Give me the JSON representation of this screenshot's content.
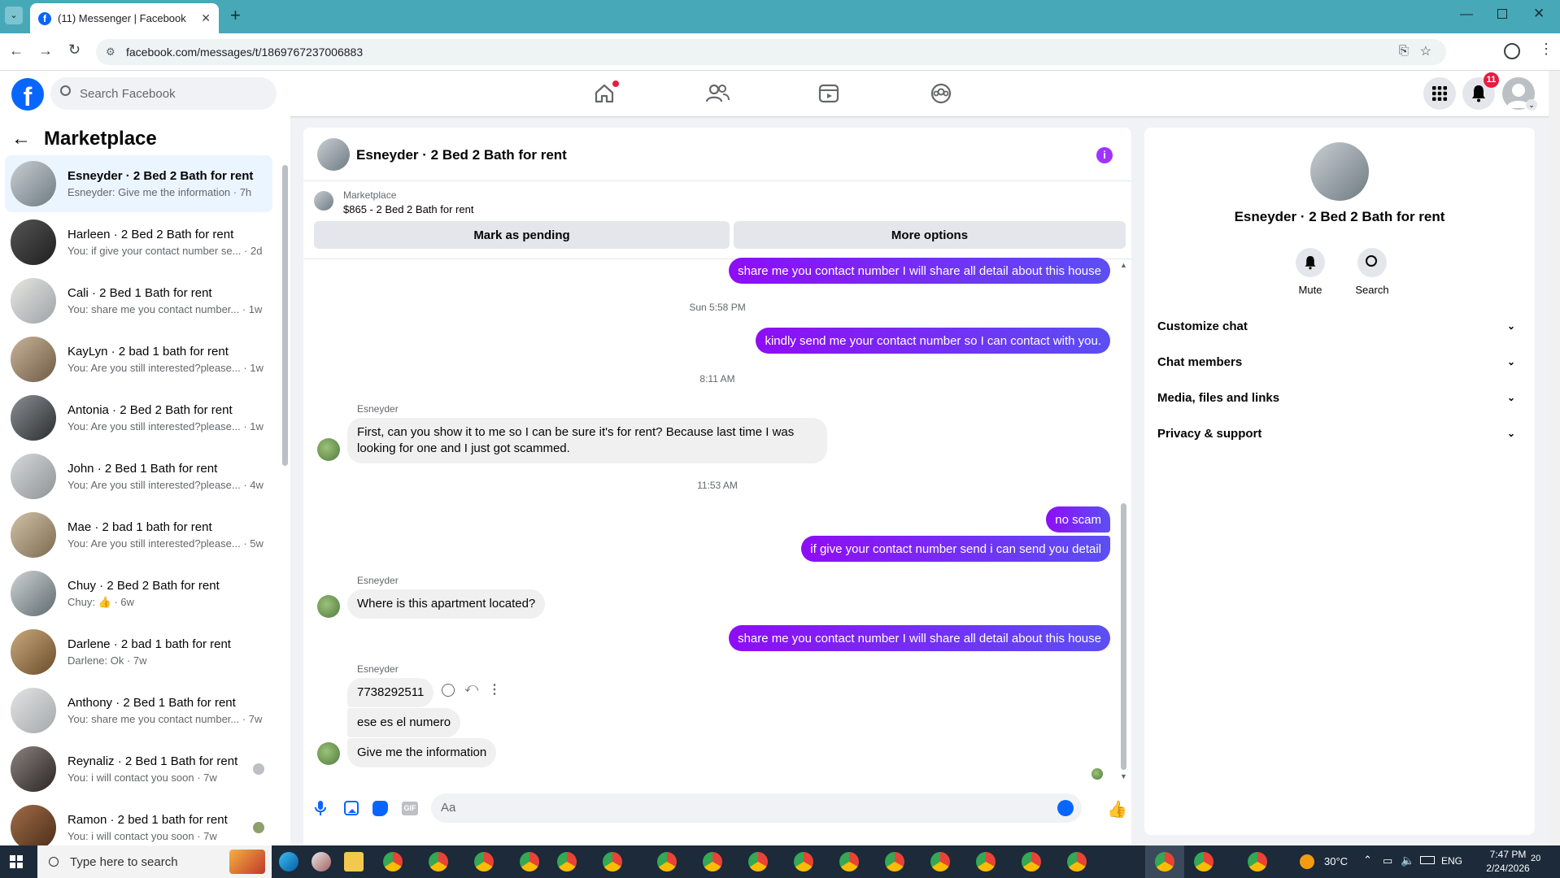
{
  "browser": {
    "tab_title": "(11) Messenger | Facebook",
    "url": "facebook.com/messages/t/1869767237006883"
  },
  "fbnav": {
    "search_placeholder": "Search Facebook",
    "notif_count": "11"
  },
  "left": {
    "title": "Marketplace",
    "conversations": [
      {
        "title": "Esneyder · 2 Bed 2 Bath for rent",
        "preview": "Esneyder: Give me the information · 7h"
      },
      {
        "title": "Harleen · 2 Bed 2 Bath for rent",
        "preview": "You: if give your contact number se... · 2d"
      },
      {
        "title": "Cali · 2 Bed 1 Bath for rent",
        "preview": "You: share me you contact number... · 1w"
      },
      {
        "title": "KayLyn · 2 bad 1 bath for rent",
        "preview": "You: Are you still interested?please... · 1w"
      },
      {
        "title": "Antonia · 2 Bed 2 Bath for rent",
        "preview": "You: Are you still interested?please... · 1w"
      },
      {
        "title": "John · 2 Bed 1 Bath for rent",
        "preview": "You: Are you still interested?please... · 4w"
      },
      {
        "title": "Mae · 2 bad 1 bath for rent",
        "preview": "You: Are you still interested?please... · 5w"
      },
      {
        "title": "Chuy · 2 Bed 2 Bath for rent",
        "preview": "Chuy: 👍 · 6w"
      },
      {
        "title": "Darlene · 2 bad 1 bath for rent",
        "preview": "Darlene: Ok · 7w"
      },
      {
        "title": "Anthony · 2 Bed 1 Bath for rent",
        "preview": "You: share me you contact number... · 7w"
      },
      {
        "title": "Reynaliz · 2 Bed 1 Bath for rent",
        "preview": "You: i will contact you soon · 7w"
      },
      {
        "title": "Ramon · 2 bed 1 bath for rent",
        "preview": "You: i will contact you soon · 7w"
      }
    ]
  },
  "chat": {
    "header_title": "Esneyder · 2 Bed 2 Bath for rent",
    "listing_source": "Marketplace",
    "listing_title": "$865 - 2 Bed 2 Bath for rent",
    "mark_pending_label": "Mark as pending",
    "more_options_label": "More options",
    "messages": {
      "m1": "share me you contact number I will share all detail about this house",
      "ts1": "Sun 5:58 PM",
      "m2": "kindly send me your contact number so I can contact with you.",
      "ts2": "8:11 AM",
      "sender": "Esneyder",
      "m3": "First, can you show it to me so I can be sure it's for rent? Because last time I was looking for one and I just got scammed.",
      "ts3": "11:53 AM",
      "m4": "no scam",
      "m5": "if give your contact number send i can send you detail",
      "m6": "Where is this apartment located?",
      "m7": "share me you contact number I will share all detail about this house",
      "m8": "7738292511",
      "m9": "ese es el numero",
      "m10": "Give me the information"
    },
    "composer_placeholder": "Aa"
  },
  "right": {
    "title": "Esneyder · 2 Bed 2 Bath for rent",
    "mute_label": "Mute",
    "search_label": "Search",
    "sections": [
      "Customize chat",
      "Chat members",
      "Media, files and links",
      "Privacy & support"
    ]
  },
  "taskbar": {
    "search_placeholder": "Type here to search",
    "weather": "30°C",
    "language": "ENG",
    "time": "7:47 PM",
    "date": "2/24/2026",
    "notif_count": "20"
  },
  "colors": {
    "fb_blue": "#0866ff",
    "messenger_purple": "#8e0df5",
    "notif_red": "#e41e3f"
  }
}
